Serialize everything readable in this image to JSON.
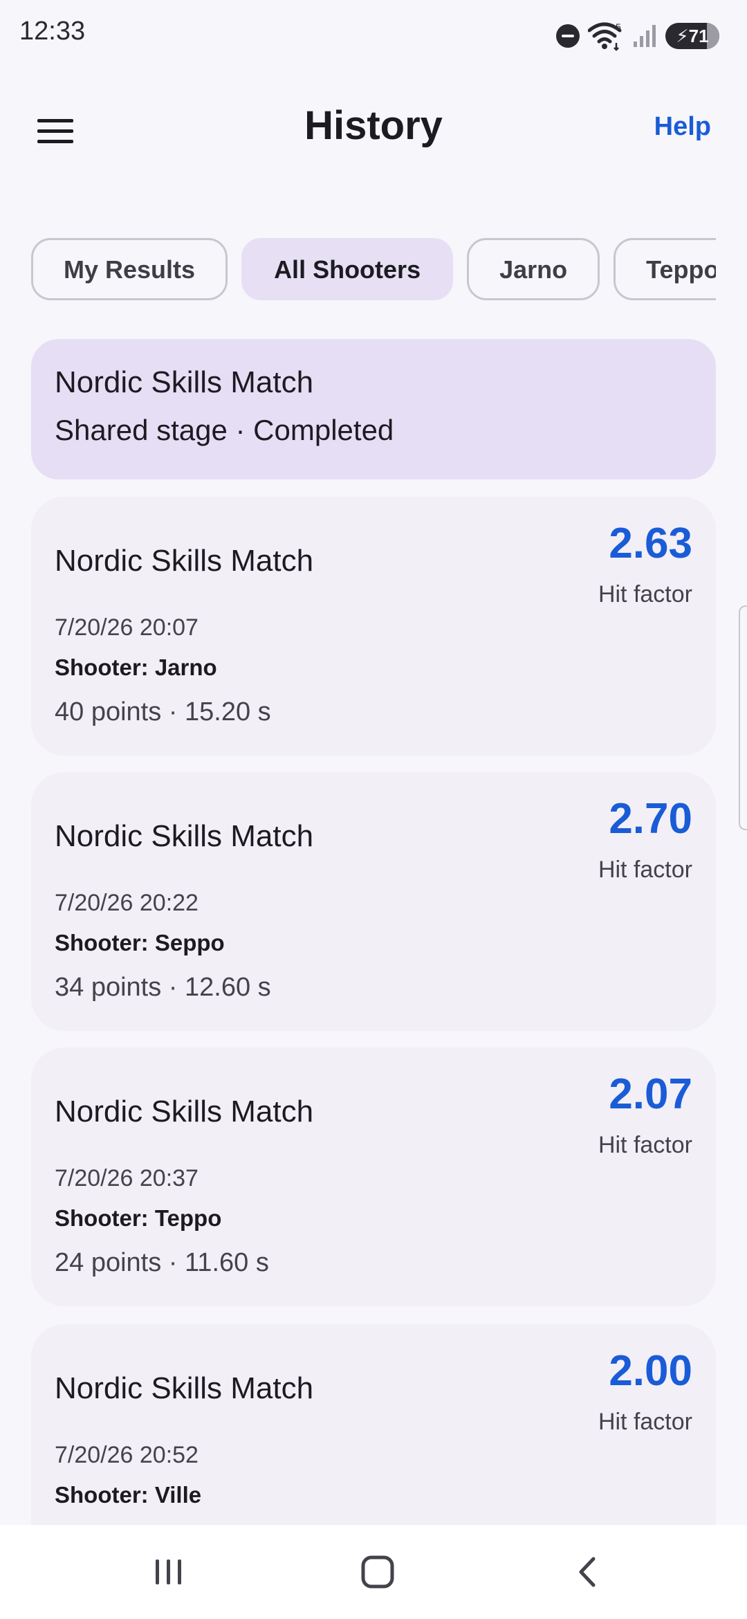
{
  "status_bar": {
    "time": "12:33",
    "wifi_badge": "5",
    "battery_level": "71",
    "icons": [
      "do-not-disturb-icon",
      "wifi-icon",
      "signal-icon",
      "battery-charging-icon"
    ]
  },
  "header": {
    "title": "History",
    "help_label": "Help",
    "menu_icon": "hamburger-menu-icon"
  },
  "filters": {
    "chips": [
      {
        "label": "My Results",
        "selected": false
      },
      {
        "label": "All Shooters",
        "selected": true
      },
      {
        "label": "Jarno",
        "selected": false
      },
      {
        "label": "Teppo",
        "selected": false
      }
    ]
  },
  "banner": {
    "title": "Nordic Skills Match",
    "subtitle": "Shared stage · Completed"
  },
  "results": [
    {
      "title": "Nordic Skills Match",
      "date": "7/20/26 20:07",
      "shooter": "Shooter: Jarno",
      "stats": "40 points · 15.20 s",
      "hit_factor": "2.63",
      "hit_factor_label": "Hit factor"
    },
    {
      "title": "Nordic Skills Match",
      "date": "7/20/26 20:22",
      "shooter": "Shooter: Seppo",
      "stats": "34 points · 12.60 s",
      "hit_factor": "2.70",
      "hit_factor_label": "Hit factor"
    },
    {
      "title": "Nordic Skills Match",
      "date": "7/20/26 20:37",
      "shooter": "Shooter: Teppo",
      "stats": "24 points · 11.60 s",
      "hit_factor": "2.07",
      "hit_factor_label": "Hit factor"
    },
    {
      "title": "Nordic Skills Match",
      "date": "7/20/26 20:52",
      "shooter": "Shooter: Ville",
      "stats": "",
      "hit_factor": "2.00",
      "hit_factor_label": "Hit factor"
    }
  ],
  "colors": {
    "accent": "#1a5cd6",
    "chip_selected": "#e7e0f4",
    "banner_bg": "#e6def5",
    "card_bg": "#f2eff7",
    "background": "#f7f6fb"
  },
  "nav_bar": {
    "icons": [
      "recent-apps-icon",
      "home-icon",
      "back-icon"
    ]
  }
}
